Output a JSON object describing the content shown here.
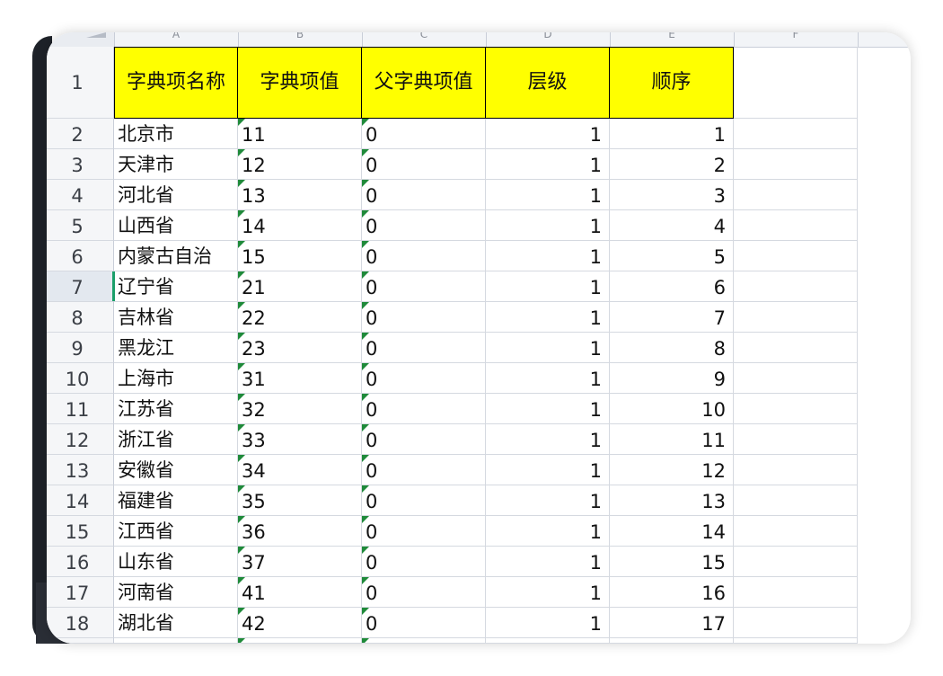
{
  "columns": [
    {
      "letter": "A"
    },
    {
      "letter": "B"
    },
    {
      "letter": "C"
    },
    {
      "letter": "D"
    },
    {
      "letter": "E"
    },
    {
      "letter": "F"
    }
  ],
  "header_row": {
    "row_number": "1",
    "cells": [
      "字典项名称",
      "字典项值",
      "父字典项值",
      "层级",
      "顺序"
    ]
  },
  "rows": [
    {
      "n": "2",
      "name": "北京市",
      "value": "11",
      "parent": "0",
      "level": "1",
      "order": "1"
    },
    {
      "n": "3",
      "name": "天津市",
      "value": "12",
      "parent": "0",
      "level": "1",
      "order": "2"
    },
    {
      "n": "4",
      "name": "河北省",
      "value": "13",
      "parent": "0",
      "level": "1",
      "order": "3"
    },
    {
      "n": "5",
      "name": "山西省",
      "value": "14",
      "parent": "0",
      "level": "1",
      "order": "4"
    },
    {
      "n": "6",
      "name": "内蒙古自治",
      "value": "15",
      "parent": "0",
      "level": "1",
      "order": "5"
    },
    {
      "n": "7",
      "name": "辽宁省",
      "value": "21",
      "parent": "0",
      "level": "1",
      "order": "6"
    },
    {
      "n": "8",
      "name": "吉林省",
      "value": "22",
      "parent": "0",
      "level": "1",
      "order": "7"
    },
    {
      "n": "9",
      "name": "黑龙江",
      "value": "23",
      "parent": "0",
      "level": "1",
      "order": "8"
    },
    {
      "n": "10",
      "name": "上海市",
      "value": "31",
      "parent": "0",
      "level": "1",
      "order": "9"
    },
    {
      "n": "11",
      "name": "江苏省",
      "value": "32",
      "parent": "0",
      "level": "1",
      "order": "10"
    },
    {
      "n": "12",
      "name": "浙江省",
      "value": "33",
      "parent": "0",
      "level": "1",
      "order": "11"
    },
    {
      "n": "13",
      "name": "安徽省",
      "value": "34",
      "parent": "0",
      "level": "1",
      "order": "12"
    },
    {
      "n": "14",
      "name": "福建省",
      "value": "35",
      "parent": "0",
      "level": "1",
      "order": "13"
    },
    {
      "n": "15",
      "name": "江西省",
      "value": "36",
      "parent": "0",
      "level": "1",
      "order": "14"
    },
    {
      "n": "16",
      "name": "山东省",
      "value": "37",
      "parent": "0",
      "level": "1",
      "order": "15"
    },
    {
      "n": "17",
      "name": "河南省",
      "value": "41",
      "parent": "0",
      "level": "1",
      "order": "16"
    },
    {
      "n": "18",
      "name": "湖北省",
      "value": "42",
      "parent": "0",
      "level": "1",
      "order": "17"
    }
  ],
  "selected_row": "7",
  "colors": {
    "header_fill": "#ffff00",
    "number_as_text_marker": "#1f8a3a",
    "selection_accent": "#1a9e6a"
  }
}
